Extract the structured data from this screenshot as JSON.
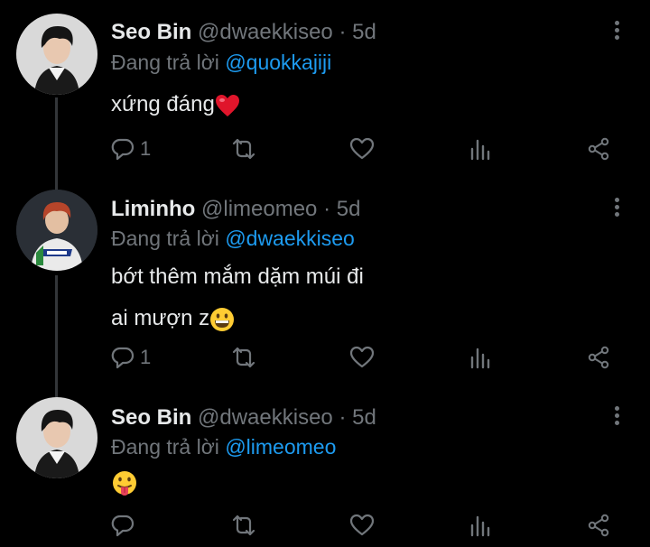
{
  "tweets": [
    {
      "name": "Seo Bin",
      "handle": "@dwaekkiseo",
      "sep": "·",
      "time": "5d",
      "reply_prefix": "Đang trả lời",
      "reply_to": "@quokkajiji",
      "lines": [
        "xứng đáng"
      ],
      "emoji": "red-heart",
      "reply_count": "1",
      "avatar_icon": "profile-photo-seo-bin"
    },
    {
      "name": "Liminho",
      "handle": "@limeomeo",
      "sep": "·",
      "time": "5d",
      "reply_prefix": "Đang trả lời",
      "reply_to": "@dwaekkiseo",
      "lines": [
        "bớt thêm mắm dặm múi đi",
        "ai mượn z"
      ],
      "emoji": "grinning-face",
      "reply_count": "1",
      "avatar_icon": "profile-photo-liminho"
    },
    {
      "name": "Seo Bin",
      "handle": "@dwaekkiseo",
      "sep": "·",
      "time": "5d",
      "reply_prefix": "Đang trả lời",
      "reply_to": "@limeomeo",
      "lines": [
        ""
      ],
      "emoji": "face-with-tongue",
      "reply_count": "",
      "avatar_icon": "profile-photo-seo-bin"
    }
  ],
  "colors": {
    "background": "#000000",
    "text": "#e7e9ea",
    "muted": "#71767b",
    "link": "#1d9bf0",
    "thread_line": "#333639"
  }
}
